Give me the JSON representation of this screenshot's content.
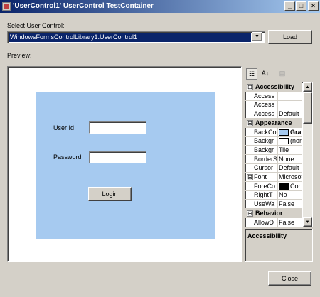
{
  "window": {
    "title": "'UserControl1' UserControl TestContainer",
    "minimize_glyph": "_",
    "maximize_glyph": "□",
    "close_glyph": "×"
  },
  "select_label": "Select User Control:",
  "combo": {
    "value": "WindowsFormsControlLibrary1.UserControl1",
    "arrow": "▼"
  },
  "load_label": "Load",
  "preview_label": "Preview:",
  "usercontrol": {
    "background_color": "#a6caf0",
    "userid_label": "User Id",
    "password_label": "Password",
    "userid_value": "",
    "password_value": "",
    "login_label": "Login"
  },
  "toolbar": {
    "categorized_glyph": "☷",
    "alphabetical_glyph": "A↓",
    "property_pages_glyph": "▤"
  },
  "property_grid": {
    "rows": [
      {
        "kind": "category",
        "expander": "⊟",
        "name": "Accessibility"
      },
      {
        "kind": "prop",
        "name": "Access",
        "value": ""
      },
      {
        "kind": "prop",
        "name": "Access",
        "value": ""
      },
      {
        "kind": "prop",
        "name": "Access",
        "value": "Default"
      },
      {
        "kind": "category",
        "expander": "⊟",
        "name": "Appearance"
      },
      {
        "kind": "prop",
        "name": "BackCo",
        "value": "Gra",
        "swatch": "#a6caf0",
        "bold": true
      },
      {
        "kind": "prop",
        "name": "Backgr",
        "value": "(non",
        "swatch": "#ffffff"
      },
      {
        "kind": "prop",
        "name": "Backgr",
        "value": "Tile"
      },
      {
        "kind": "prop",
        "name": "BorderS",
        "value": "None"
      },
      {
        "kind": "prop",
        "name": "Cursor",
        "value": "Default"
      },
      {
        "kind": "prop",
        "name": "Font",
        "value": "Microsoft",
        "expander": "⊞"
      },
      {
        "kind": "prop",
        "name": "ForeCo",
        "value": "Cor",
        "swatch": "#000000"
      },
      {
        "kind": "prop",
        "name": "RightT",
        "value": "No"
      },
      {
        "kind": "prop",
        "name": "UseWa",
        "value": "False"
      },
      {
        "kind": "category",
        "expander": "⊟",
        "name": "Behavior"
      },
      {
        "kind": "prop",
        "name": "AllowD",
        "value": "False"
      }
    ],
    "scroll_up": "▲",
    "scroll_down": "▼"
  },
  "description": {
    "title": "Accessibility"
  },
  "close_label": "Close"
}
